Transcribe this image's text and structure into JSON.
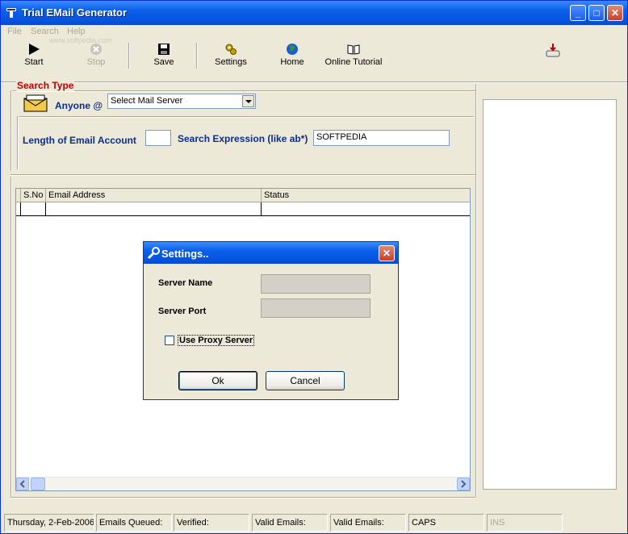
{
  "window": {
    "title": "Trial EMail Generator",
    "minimize": "_",
    "maximize": "□",
    "close": "✕"
  },
  "menu": [
    "File",
    "Search",
    "Help"
  ],
  "watermark": "www.softpedia.com",
  "toolbar": {
    "start": "Start",
    "stop": "Stop",
    "save": "Save",
    "settings": "Settings",
    "home": "Home",
    "online_tutorial": "Online Tutorial"
  },
  "search": {
    "group_label": "Search Type",
    "anyone_label": "Anyone @",
    "mail_server_value": "Select Mail Server",
    "length_label": "Length of Email Account",
    "length_value": "",
    "expression_label": "Search Expression (like ab*)",
    "expression_value": "SOFTPEDIA"
  },
  "table": {
    "columns": [
      "S.No",
      "Email Address",
      "Status"
    ]
  },
  "dialog": {
    "title": "Settings..",
    "server_name_label": "Server Name",
    "server_port_label": "Server Port",
    "proxy_label": "Use Proxy Server",
    "proxy_checked": false,
    "ok": "Ok",
    "cancel": "Cancel",
    "close": "✕"
  },
  "status": {
    "date": "Thursday, 2-Feb-2006",
    "queued": "Emails Queued:",
    "verified": "Verified:",
    "valid1": "Valid Emails:",
    "valid2": "Valid Emails:",
    "caps": "CAPS",
    "ins": "INS"
  }
}
